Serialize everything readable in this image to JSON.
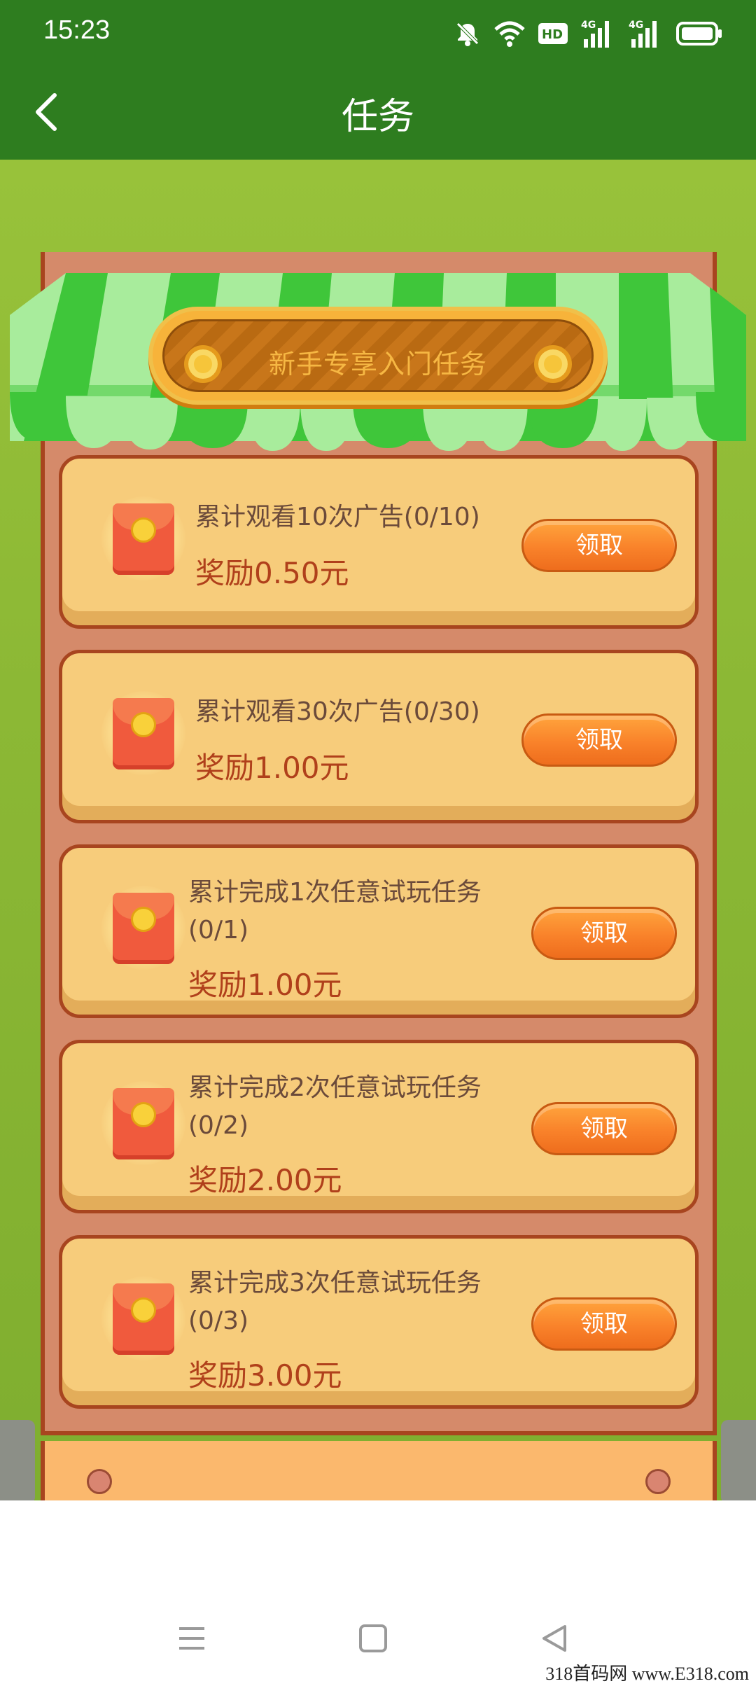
{
  "status_bar": {
    "time": "15:23",
    "icons": [
      "mute-icon",
      "wifi-icon",
      "hd-icon",
      "signal-4g-icon",
      "signal-4g-icon",
      "battery-icon"
    ],
    "hd_label": "HD",
    "network_label": "4G"
  },
  "header": {
    "title": "任务",
    "back_icon": "chevron-left-icon"
  },
  "banner": {
    "title": "新手专享入门任务"
  },
  "tasks": [
    {
      "title_line1": "累计观看10次广告(0/10)",
      "title_line2": "",
      "reward": "奖励0.50元",
      "button": "领取"
    },
    {
      "title_line1": "累计观看30次广告(0/30)",
      "title_line2": "",
      "reward": "奖励1.00元",
      "button": "领取"
    },
    {
      "title_line1": "累计完成1次任意试玩任务",
      "title_line2": "(0/1)",
      "reward": "奖励1.00元",
      "button": "领取"
    },
    {
      "title_line1": "累计完成2次任意试玩任务",
      "title_line2": "(0/2)",
      "reward": "奖励2.00元",
      "button": "领取"
    },
    {
      "title_line1": "累计完成3次任意试玩任务",
      "title_line2": "(0/3)",
      "reward": "奖励3.00元",
      "button": "领取"
    }
  ],
  "nav": {
    "icons": [
      "menu-icon",
      "home-square-icon",
      "back-triangle-icon"
    ]
  },
  "watermark": "318首码网 www.E318.com",
  "colors": {
    "header": "#2e7d1f",
    "awning_light": "#a8ec9c",
    "awning_dark": "#3fc63a",
    "card": "#f7cc7b",
    "button": "#f9822a",
    "reward_text": "#b0401b"
  }
}
